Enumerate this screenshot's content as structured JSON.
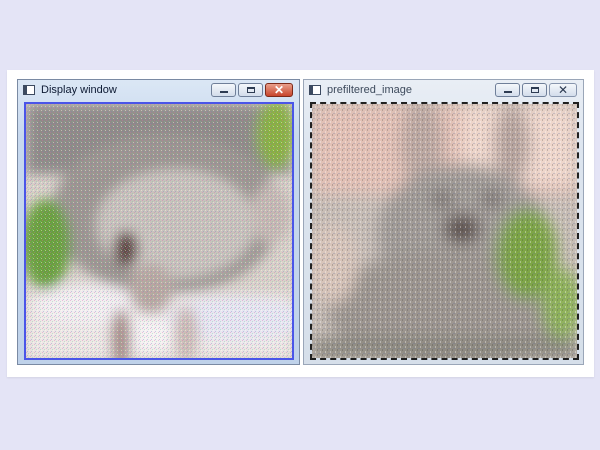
{
  "windows": [
    {
      "title": "Display window",
      "controls": [
        "minimize",
        "maximize",
        "close"
      ],
      "content_icon": "rabbit-image-rotated"
    },
    {
      "title": "prefiltered_image",
      "controls": [
        "minimize",
        "maximize",
        "close"
      ],
      "content_icon": "rabbit-image-blurred"
    }
  ],
  "colors": {
    "page_background": "#e4e4f6",
    "active_border": "#4a55e8",
    "close_button": "#c8452c"
  }
}
